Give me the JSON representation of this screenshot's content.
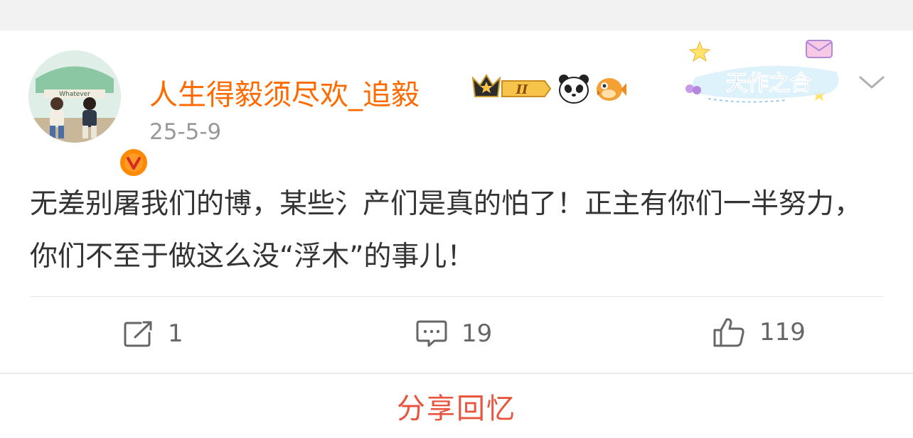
{
  "post": {
    "username": "人生得毅须尽欢_追毅",
    "timestamp": "25-5-9",
    "level_badge": "II",
    "sticker_text": "天作之合",
    "avatar_text": "Whatever",
    "text": "无差别屠我们的博，某些氵产们是真的怕了！正主有你们一半努力，你们不至于做这么没“浮木”的事儿！"
  },
  "actions": {
    "repost_count": "1",
    "comment_count": "19",
    "like_count": "119"
  },
  "footer": {
    "share_label": "分享回忆"
  },
  "colors": {
    "username": "#ff6a00",
    "share": "#e8543e",
    "verified": "#ff8a00"
  },
  "icons": [
    "verified-icon",
    "crown-icon",
    "panda-icon",
    "fish-icon",
    "chevron-down-icon",
    "repost-icon",
    "comment-icon",
    "like-icon"
  ]
}
